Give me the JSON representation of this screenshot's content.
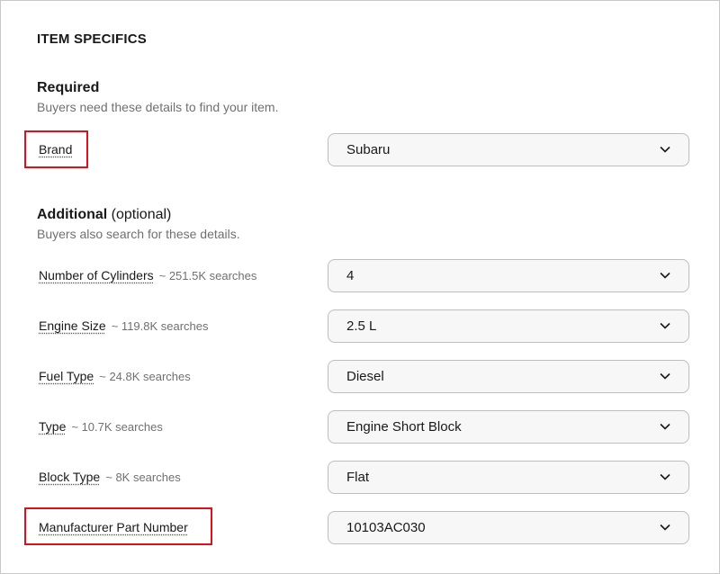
{
  "section_title": "ITEM SPECIFICS",
  "required": {
    "title": "Required",
    "subtitle": "Buyers need these details to find your item.",
    "fields": [
      {
        "label": "Brand",
        "value": "Subaru"
      }
    ]
  },
  "additional": {
    "title": "Additional",
    "title_suffix": "(optional)",
    "subtitle": "Buyers also search for these details.",
    "fields": [
      {
        "label": "Number of Cylinders",
        "searches": "~ 251.5K searches",
        "value": "4"
      },
      {
        "label": "Engine Size",
        "searches": "~ 119.8K searches",
        "value": "2.5 L"
      },
      {
        "label": "Fuel Type",
        "searches": "~ 24.8K searches",
        "value": "Diesel"
      },
      {
        "label": "Type",
        "searches": "~ 10.7K searches",
        "value": "Engine Short Block"
      },
      {
        "label": "Block Type",
        "searches": "~ 8K searches",
        "value": "Flat"
      },
      {
        "label": "Manufacturer Part Number",
        "searches": "",
        "value": "10103AC030"
      }
    ]
  },
  "colors": {
    "highlight": "#e0101a",
    "select_bg": "#f7f7f7",
    "secondary_text": "#707070"
  },
  "icons": {
    "dropdown": "chevron-down-icon"
  }
}
